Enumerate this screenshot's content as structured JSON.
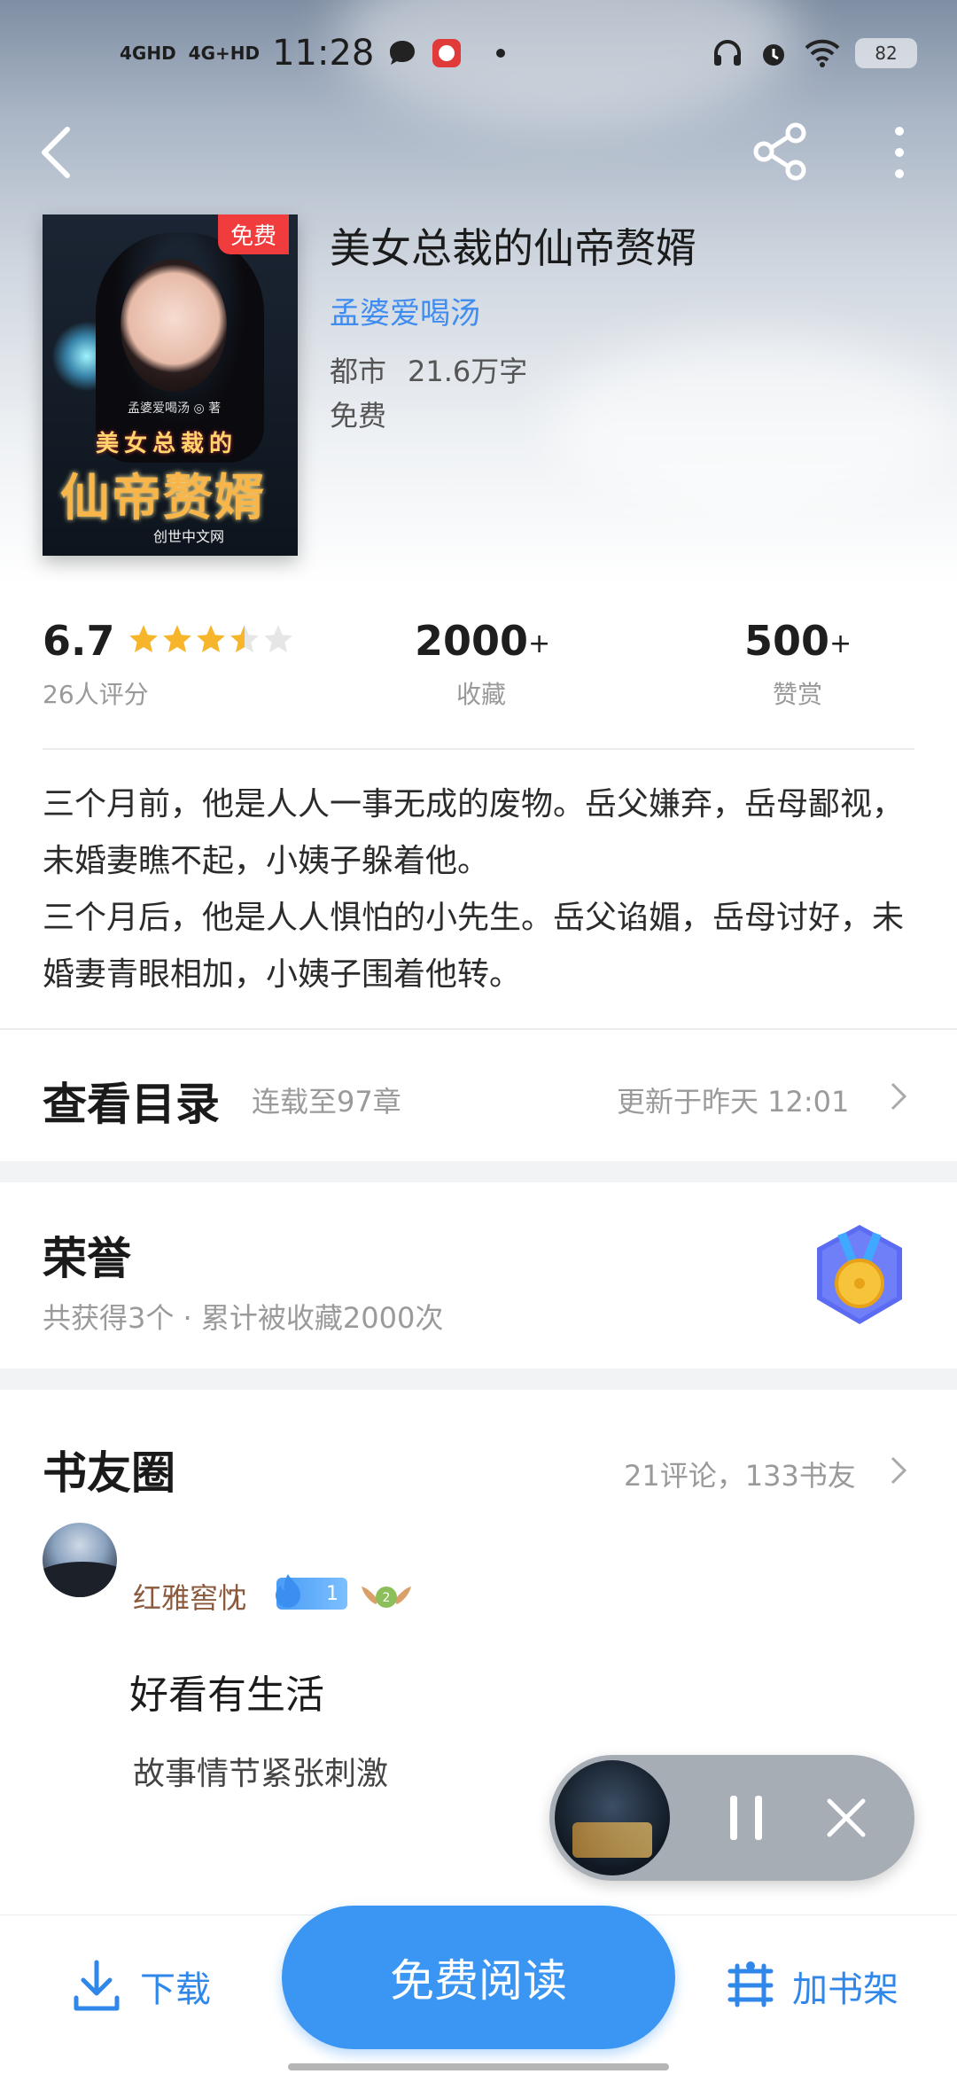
{
  "status_bar": {
    "network1": "4GHD",
    "network2": "4G+HD",
    "time": "11:28",
    "battery": "82"
  },
  "book": {
    "cover_tag": "免费",
    "cover_author": "孟婆爱喝汤 ◎ 著",
    "cover_title_small": "美女总裁的",
    "cover_title_big": "仙帝赘婿",
    "cover_publisher": "创世中文网",
    "title": "美女总裁的仙帝赘婿",
    "author": "孟婆爱喝汤",
    "category": "都市",
    "word_count": "21.6万字",
    "price": "免费"
  },
  "stats": {
    "rating": "6.7",
    "rating_stars": 3.5,
    "rating_count": "26人评分",
    "favorites": "2000",
    "favorites_suffix": "+",
    "favorites_label": "收藏",
    "rewards": "500",
    "rewards_suffix": "+",
    "rewards_label": "赞赏"
  },
  "description": {
    "line1": "三个月前，他是人人一事无成的废物。岳父嫌弃，岳母鄙视，未婚妻瞧不起，小姨子躲着他。",
    "line2": "三个月后，他是人人惧怕的小先生。岳父谄媚，岳母讨好，未婚妻青眼相加，小姨子围着他转。"
  },
  "catalog": {
    "title": "查看目录",
    "status": "连载至97章",
    "updated": "更新于昨天 12:01"
  },
  "honor": {
    "title": "荣誉",
    "summary": "共获得3个 · 累计被收藏2000次"
  },
  "circle": {
    "title": "书友圈",
    "summary": "21评论，133书友"
  },
  "comment": {
    "username": "红雅窖忱",
    "level": "1",
    "rank": "2",
    "title": "好看有生活",
    "body": "故事情节紧张刺激"
  },
  "bottom": {
    "download": "下载",
    "read": "免费阅读",
    "add_shelf": "加书架"
  },
  "colors": {
    "accent": "#3a96f2",
    "author_link": "#3f8cf0",
    "star": "#f7b52c",
    "username": "#8b5a3c"
  }
}
